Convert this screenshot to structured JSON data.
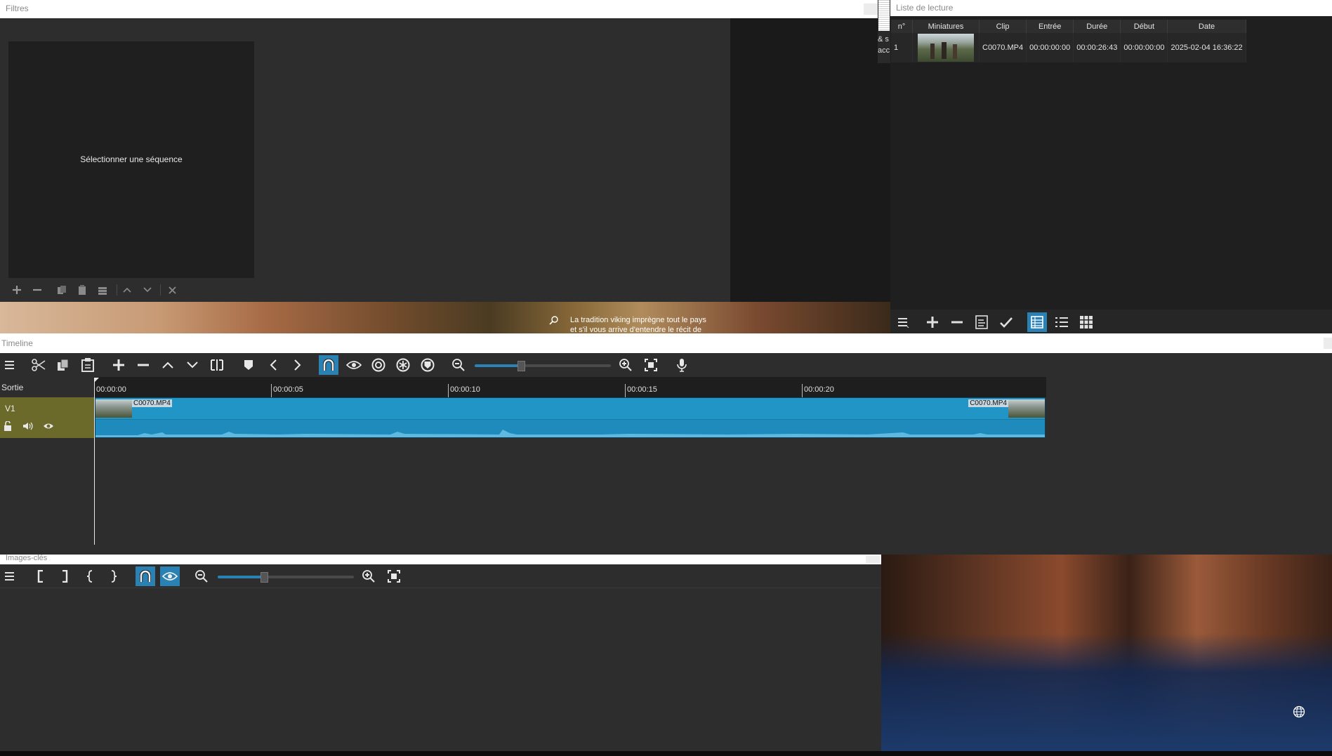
{
  "filters": {
    "title": "Filtres",
    "placeholder": "Sélectionner une séquence",
    "toolbar_icons": [
      "add-icon",
      "remove-icon",
      "copy-icon",
      "paste-icon",
      "save-preset-icon",
      "move-up-icon",
      "move-down-icon",
      "deselect-icon"
    ]
  },
  "playlist": {
    "title": "Liste de lecture",
    "columns": [
      "n°",
      "Miniatures",
      "Clip",
      "Entrée",
      "Durée",
      "Début",
      "Date"
    ],
    "rows": [
      {
        "num": "1",
        "clip": "C0070.MP4",
        "in": "00:00:00:00",
        "duration": "00:00:26:43",
        "start": "00:00:00:00",
        "date": "2025-02-04 16:36:22"
      }
    ],
    "toolbar_icons": [
      "menu-icon",
      "add-icon",
      "remove-icon",
      "update-icon",
      "check-icon",
      "details-view-icon",
      "list-view-icon",
      "grid-view-icon"
    ]
  },
  "desktop": {
    "caption_line1": "La tradition viking imprègne tout le pays",
    "caption_line2": "et s'il vous arrive d'entendre le récit de",
    "edge_text1": "& s",
    "edge_text2": "acc"
  },
  "timeline": {
    "title": "Timeline",
    "output_label": "Sortie",
    "track_name": "V1",
    "ruler_ticks": [
      "00:00:00",
      "00:00:05",
      "00:00:10",
      "00:00:15",
      "00:00:20"
    ],
    "clip_label_start": "C0070.MP4",
    "clip_label_end": "C0070.MP4",
    "accent": "#2a82b4",
    "track_header_color": "#6b6a2a",
    "snap_active": true,
    "zoom_fraction": 0.34
  },
  "keyframes": {
    "title": "Images-clés",
    "snap_active": true,
    "scrub_active": true,
    "zoom_fraction": 0.34
  }
}
